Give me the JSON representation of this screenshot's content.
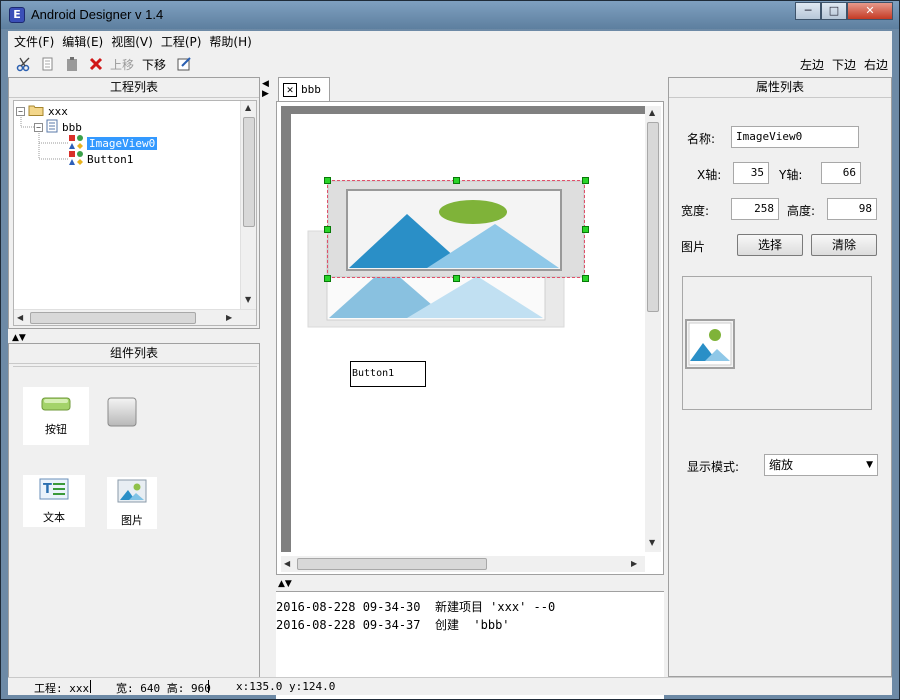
{
  "window": {
    "title": "Android Designer v 1.4",
    "app_icon": "E"
  },
  "menu": [
    "文件(F)",
    "编辑(E)",
    "视图(V)",
    "工程(P)",
    "帮助(H)"
  ],
  "toolbar": {
    "move_up": "上移",
    "move_down": "下移",
    "align_left": "左边",
    "align_bottom": "下边",
    "align_right": "右边"
  },
  "project_panel": {
    "title": "工程列表",
    "tree": [
      {
        "label": "xxx",
        "icon": "folder-open-icon"
      },
      {
        "label": "bbb",
        "icon": "document-icon"
      },
      {
        "label": "ImageView0",
        "icon": "widget-shapes-icon",
        "selected": true
      },
      {
        "label": "Button1",
        "icon": "widget-shapes-icon"
      }
    ]
  },
  "component_panel": {
    "title": "组件列表",
    "items": [
      {
        "label": "按钮",
        "icon": "button-widget-icon"
      },
      {
        "label": "",
        "icon": "gray-square-widget-icon"
      },
      {
        "label": "文本",
        "icon": "text-widget-icon"
      },
      {
        "label": "图片",
        "icon": "image-widget-icon"
      }
    ]
  },
  "editor": {
    "tab": "bbb",
    "button_widget": "Button1"
  },
  "log": [
    "2016-08-228 09-34-30  新建项目 'xxx' --0",
    "2016-08-228 09-34-37  创建  'bbb'"
  ],
  "properties": {
    "title": "属性列表",
    "name_label": "名称:",
    "name_value": "ImageView0",
    "x_label": "X轴:",
    "x_value": "35",
    "y_label": "Y轴:",
    "y_value": "66",
    "width_label": "宽度:",
    "width_value": "258",
    "height_label": "高度:",
    "height_value": "98",
    "image_label": "图片",
    "choose_button": "选择",
    "clear_button": "清除",
    "display_mode_label": "显示模式:",
    "display_mode_value": "缩放"
  },
  "status": {
    "project": "工程: xxx",
    "size": "宽: 640 高: 960",
    "coords": "x:135.0 y:124.0"
  },
  "colors": {
    "selection": "#3399ff",
    "handle": "#2ad42a",
    "close_button": "#c43a24"
  }
}
